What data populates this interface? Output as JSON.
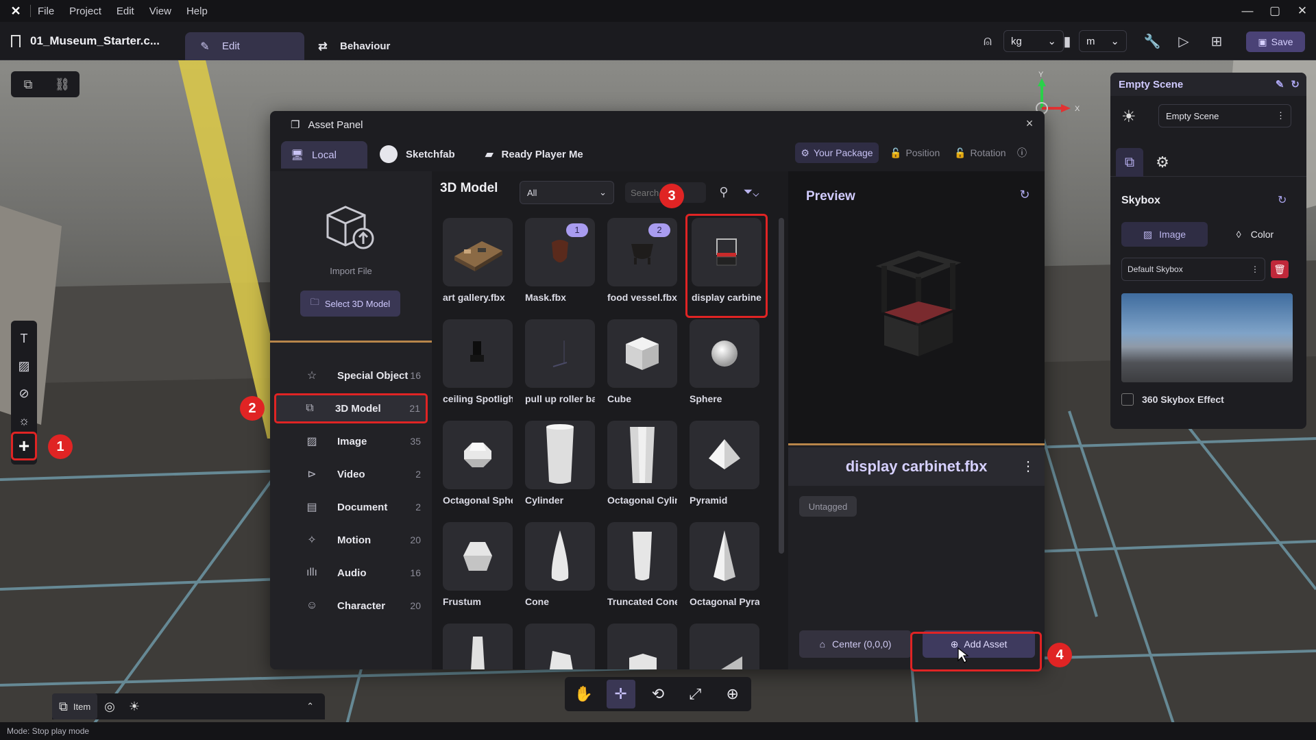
{
  "menubar": {
    "items": [
      "File",
      "Project",
      "Edit",
      "View",
      "Help"
    ]
  },
  "toolbar": {
    "project_title": "01_Museum_Starter.c...",
    "tabs": [
      {
        "label": "Edit"
      },
      {
        "label": "Behaviour"
      }
    ],
    "unit_mass": "kg",
    "unit_length": "m",
    "save_label": "Save"
  },
  "asset_panel": {
    "title": "Asset Panel",
    "close_glyph": "×",
    "tabs": [
      {
        "label": "Local"
      },
      {
        "label": "Sketchfab"
      },
      {
        "label": "Ready Player Me"
      }
    ],
    "your_package_label": "Your Package",
    "position_label": "Position",
    "rotation_label": "Rotation",
    "import_label": "Import File",
    "select_3d_label": "Select 3D Model",
    "categories": [
      {
        "label": "Special Object",
        "count": "16",
        "icon": "star-icon"
      },
      {
        "label": "3D Model",
        "count": "21",
        "icon": "cube-icon"
      },
      {
        "label": "Image",
        "count": "35",
        "icon": "image-icon"
      },
      {
        "label": "Video",
        "count": "2",
        "icon": "play-icon"
      },
      {
        "label": "Document",
        "count": "2",
        "icon": "document-icon"
      },
      {
        "label": "Motion",
        "count": "20",
        "icon": "motion-icon"
      },
      {
        "label": "Audio",
        "count": "16",
        "icon": "audio-icon"
      },
      {
        "label": "Character",
        "count": "20",
        "icon": "character-icon"
      }
    ],
    "grid_title": "3D Model",
    "filter_value": "All",
    "search_placeholder": "Search",
    "assets": [
      {
        "label": "art gallery.fbx",
        "badge": ""
      },
      {
        "label": "Mask.fbx",
        "badge": "1"
      },
      {
        "label": "food vessel.fbx",
        "badge": "2"
      },
      {
        "label": "display carbinet.fbx",
        "badge": ""
      },
      {
        "label": "ceiling Spotlight",
        "badge": ""
      },
      {
        "label": "pull up roller bar",
        "badge": ""
      },
      {
        "label": "Cube",
        "badge": ""
      },
      {
        "label": "Sphere",
        "badge": ""
      },
      {
        "label": "Octagonal Sphere",
        "badge": ""
      },
      {
        "label": "Cylinder",
        "badge": ""
      },
      {
        "label": "Octagonal Cylinder",
        "badge": ""
      },
      {
        "label": "Pyramid",
        "badge": ""
      },
      {
        "label": "Frustum",
        "badge": ""
      },
      {
        "label": "Cone",
        "badge": ""
      },
      {
        "label": "Truncated Cone",
        "badge": ""
      },
      {
        "label": "Octagonal Pyramid",
        "badge": ""
      }
    ],
    "preview": {
      "title": "Preview",
      "asset_name": "display carbinet.fbx",
      "tag": "Untagged",
      "center_label": "Center (0,0,0)",
      "add_asset_label": "Add Asset"
    }
  },
  "right_panel": {
    "title": "Empty Scene",
    "scene_select": "Empty Scene",
    "skybox_title": "Skybox",
    "image_tab": "Image",
    "color_tab": "Color",
    "skybox_select": "Default Skybox",
    "skybox_360_label": "360 Skybox Effect"
  },
  "bottom": {
    "item_label": "Item",
    "status_text": "Mode: Stop play mode"
  },
  "annotations": [
    "1",
    "2",
    "3",
    "4"
  ],
  "colors": {
    "accent": "#3a3754",
    "accent_text": "#d0caff",
    "highlight": "#e02424",
    "divider": "#b8864a"
  }
}
